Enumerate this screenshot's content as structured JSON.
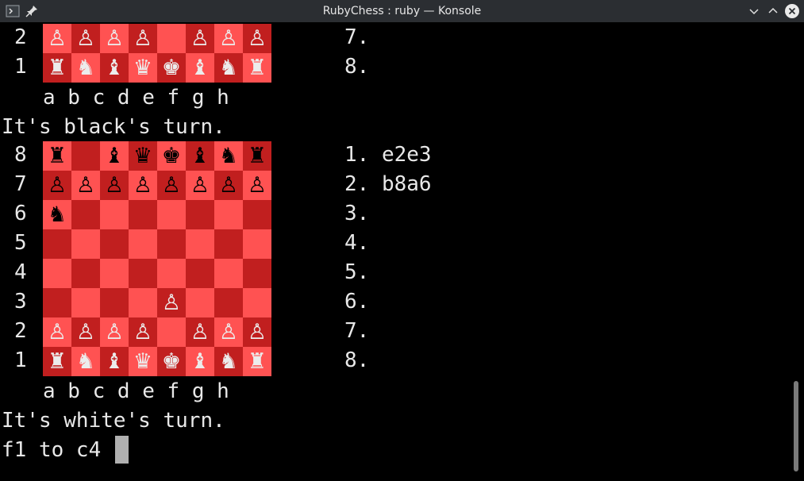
{
  "window": {
    "title": "RubyChess : ruby — Konsole"
  },
  "board_top": {
    "rank_labels": [
      "2",
      "1"
    ],
    "ranks": [
      [
        "wp",
        "wp",
        "wp",
        "wp",
        "",
        "wp",
        "wp",
        "wp"
      ],
      [
        "wr",
        "wn",
        "wb",
        "wq",
        "wk",
        "wb",
        "wn",
        "wr"
      ]
    ],
    "files": "a b c d e f g h",
    "moves": [
      "7.",
      "8."
    ]
  },
  "turn1": "It's black's turn.",
  "board_main": {
    "rank_labels": [
      "8",
      "7",
      "6",
      "5",
      "4",
      "3",
      "2",
      "1"
    ],
    "ranks": [
      [
        "br",
        "",
        "bb",
        "bq",
        "bk",
        "bb",
        "bn",
        "br"
      ],
      [
        "bp",
        "bp",
        "bp",
        "bp",
        "bp",
        "bp",
        "bp",
        "bp"
      ],
      [
        "bn",
        "",
        "",
        "",
        "",
        "",
        "",
        ""
      ],
      [
        "",
        "",
        "",
        "",
        "",
        "",
        "",
        ""
      ],
      [
        "",
        "",
        "",
        "",
        "",
        "",
        "",
        ""
      ],
      [
        "",
        "",
        "",
        "",
        "wp",
        "",
        "",
        ""
      ],
      [
        "wp",
        "wp",
        "wp",
        "wp",
        "",
        "wp",
        "wp",
        "wp"
      ],
      [
        "wr",
        "wn",
        "wb",
        "wq",
        "wk",
        "wb",
        "wn",
        "wr"
      ]
    ],
    "files": "a b c d e f g h",
    "moves": [
      "1. e2e3",
      "2. b8a6",
      "3.",
      "4.",
      "5.",
      "6.",
      "7.",
      "8."
    ]
  },
  "turn2": "It's white's turn.",
  "input_line": "f1 to c4",
  "glyphs": {
    "p": "♙",
    "r": "♜",
    "n": "♞",
    "b": "♝",
    "q": "♛",
    "k": "♚"
  }
}
